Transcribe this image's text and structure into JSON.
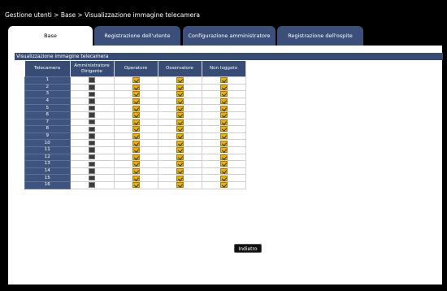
{
  "breadcrumb": "Gestione utenti > Base > Visualizzazione immagine telecamera",
  "tabs": [
    {
      "label": "Base",
      "active": true
    },
    {
      "label": "Registrazione dell'utente",
      "active": false
    },
    {
      "label": "Configurazione amministratore",
      "active": false
    },
    {
      "label": "Registrazione dell'ospite",
      "active": false
    }
  ],
  "section_title": "Visualizzazione immagine telecamera",
  "table": {
    "headers": {
      "camera": "Telecamera",
      "admin_line1": "Amministratore",
      "admin_line2": "Dirigente",
      "operator": "Operatore",
      "observer": "Osservatore",
      "not_logged": "Non loggato"
    },
    "rows": [
      {
        "camera": "1",
        "admin": "disabled",
        "operator": true,
        "observer": true,
        "not_logged": true
      },
      {
        "camera": "2",
        "admin": "disabled",
        "operator": true,
        "observer": true,
        "not_logged": true
      },
      {
        "camera": "3",
        "admin": "disabled",
        "operator": true,
        "observer": true,
        "not_logged": true
      },
      {
        "camera": "4",
        "admin": "disabled",
        "operator": true,
        "observer": true,
        "not_logged": true
      },
      {
        "camera": "5",
        "admin": "disabled",
        "operator": true,
        "observer": true,
        "not_logged": true
      },
      {
        "camera": "6",
        "admin": "disabled",
        "operator": true,
        "observer": true,
        "not_logged": true
      },
      {
        "camera": "7",
        "admin": "disabled",
        "operator": true,
        "observer": true,
        "not_logged": true
      },
      {
        "camera": "8",
        "admin": "disabled",
        "operator": true,
        "observer": true,
        "not_logged": true
      },
      {
        "camera": "9",
        "admin": "disabled",
        "operator": true,
        "observer": true,
        "not_logged": true
      },
      {
        "camera": "10",
        "admin": "disabled",
        "operator": true,
        "observer": true,
        "not_logged": true
      },
      {
        "camera": "11",
        "admin": "disabled",
        "operator": true,
        "observer": true,
        "not_logged": true
      },
      {
        "camera": "12",
        "admin": "disabled",
        "operator": true,
        "observer": true,
        "not_logged": true
      },
      {
        "camera": "13",
        "admin": "disabled",
        "operator": true,
        "observer": true,
        "not_logged": true
      },
      {
        "camera": "14",
        "admin": "disabled",
        "operator": true,
        "observer": true,
        "not_logged": true
      },
      {
        "camera": "15",
        "admin": "disabled",
        "operator": true,
        "observer": true,
        "not_logged": true
      },
      {
        "camera": "16",
        "admin": "disabled",
        "operator": true,
        "observer": true,
        "not_logged": true
      }
    ]
  },
  "back_button": "Indietro",
  "colors": {
    "header_bg": "#374c74",
    "checkbox_checked": "#f0b000",
    "checkmark": "#1a3070",
    "checkbox_disabled": "#3b3b3b"
  },
  "icons": {
    "checked": "checkbox-checked-icon",
    "disabled": "checkbox-disabled-icon"
  }
}
